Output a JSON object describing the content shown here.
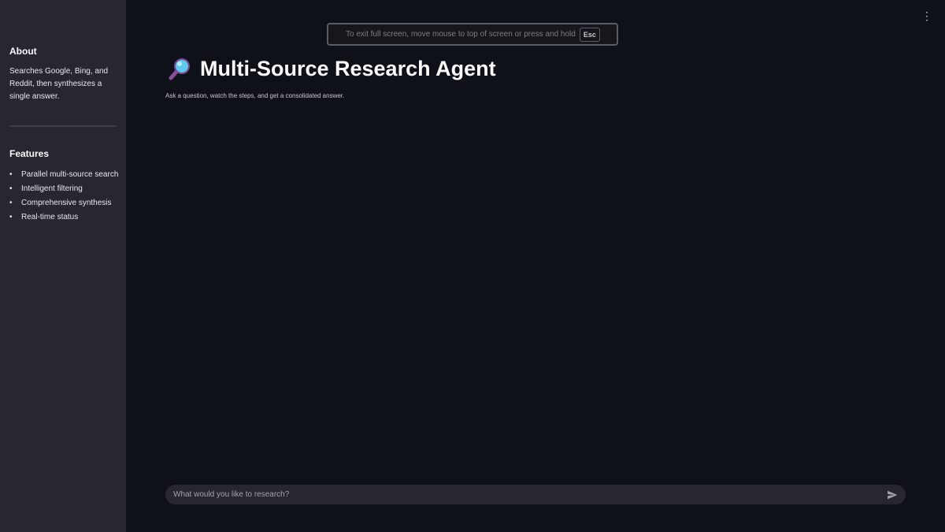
{
  "sidebar": {
    "about_heading": "About",
    "about_text": "Searches Google, Bing, and Reddit, then synthesizes a single answer.",
    "features_heading": "Features",
    "features": [
      "Parallel multi-source search",
      "Intelligent filtering",
      "Comprehensive synthesis",
      "Real-time status"
    ]
  },
  "fullscreen_banner": {
    "text": "To exit full screen, move mouse to top of screen or press and hold",
    "key": "Esc"
  },
  "main": {
    "title": "Multi-Source Research Agent",
    "subtitle": "Ask a question, watch the steps, and get a consolidated answer."
  },
  "chat": {
    "placeholder": "What would you like to research?",
    "value": ""
  },
  "icons": {
    "title_icon": "magnifying-glass-icon",
    "menu": "kebab-menu-icon",
    "send": "send-icon"
  }
}
